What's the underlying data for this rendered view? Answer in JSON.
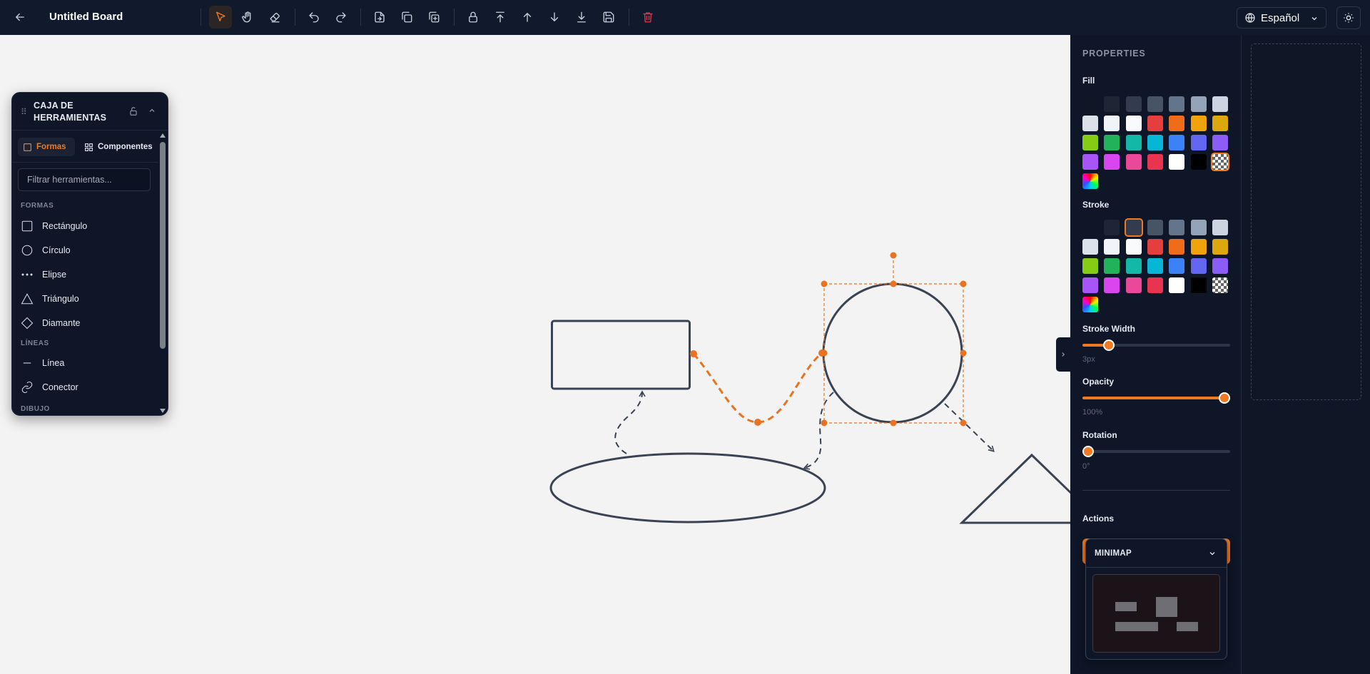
{
  "topbar": {
    "board_title": "Untitled Board",
    "language": "Español",
    "tools": [
      "back-icon",
      "select-icon",
      "hand-icon",
      "eraser-icon",
      "undo-icon",
      "redo-icon",
      "export-icon",
      "copy-icon",
      "duplicate-icon",
      "lock-icon",
      "bring-to-front-icon",
      "bring-forward-icon",
      "send-backward-icon",
      "send-to-back-icon",
      "save-icon",
      "trash-icon"
    ],
    "active_tool": "select-icon"
  },
  "toolbox": {
    "title": "CAJA DE HERRAMIENTAS",
    "tabs": [
      {
        "label": "Formas",
        "active": true
      },
      {
        "label": "Componentes",
        "active": false
      }
    ],
    "filter_placeholder": "Filtrar herramientas...",
    "sections": [
      {
        "label": "FORMAS",
        "items": [
          {
            "label": "Rectángulo",
            "icon": "rectangle-icon"
          },
          {
            "label": "Círculo",
            "icon": "circle-icon"
          },
          {
            "label": "Elipse",
            "icon": "ellipse-icon"
          },
          {
            "label": "Triángulo",
            "icon": "triangle-icon"
          },
          {
            "label": "Diamante",
            "icon": "diamond-icon"
          }
        ]
      },
      {
        "label": "LÍNEAS",
        "items": [
          {
            "label": "Línea",
            "icon": "line-icon"
          },
          {
            "label": "Conector",
            "icon": "link-icon"
          }
        ]
      },
      {
        "label": "DIBUJO",
        "items": []
      }
    ]
  },
  "properties": {
    "title": "PROPERTIES",
    "fill_label": "Fill",
    "stroke_label": "Stroke",
    "stroke_width_label": "Stroke Width",
    "stroke_width_value": "3px",
    "stroke_width_fraction": 0.18,
    "opacity_label": "Opacity",
    "opacity_value": "100%",
    "opacity_fraction": 1.0,
    "rotation_label": "Rotation",
    "rotation_value": "0°",
    "rotation_fraction": 0.0,
    "actions_label": "Actions",
    "palette": [
      "#0f1626",
      "#1e2636",
      "#323c4e",
      "#475466",
      "#64748b",
      "#94a3b8",
      "#cbd5e1",
      "#dbe2ea",
      "#f1f5f9",
      "#f8fafc",
      "#e53e3e",
      "#ee6c1a",
      "#f0a30a",
      "#dca80e",
      "#84cc16",
      "#22b25a",
      "#14b8a6",
      "#06b6d4",
      "#3b82f6",
      "#6366f1",
      "#8b5cf6",
      "#a855f7",
      "#d946ef",
      "#ec4899",
      "#e8344e",
      "#ffffff",
      "#000000",
      "transparent",
      "rainbow"
    ],
    "fill_selected": "transparent",
    "stroke_selected": "#323c4e"
  },
  "minimap": {
    "title": "MINIMAP"
  },
  "colors": {
    "accent": "#f07a22",
    "shape_stroke": "#3a4354",
    "canvas_bg": "#f3f3f3",
    "panel_bg": "#0e1627"
  }
}
